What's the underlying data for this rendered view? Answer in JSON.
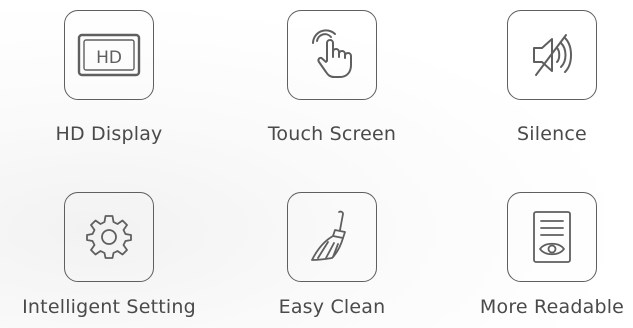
{
  "features": [
    {
      "label": "HD Display",
      "icon": "hd-display-icon",
      "icon_text": "HD"
    },
    {
      "label": "Touch Screen",
      "icon": "touch-hand-icon"
    },
    {
      "label": "Silence",
      "icon": "mute-speaker-icon"
    },
    {
      "label": "Intelligent Setting",
      "icon": "gear-icon"
    },
    {
      "label": "Easy Clean",
      "icon": "broom-icon"
    },
    {
      "label": "More Readable",
      "icon": "document-eye-icon"
    }
  ],
  "colors": {
    "stroke": "#5f5f5f",
    "text": "#4a4a4a"
  }
}
